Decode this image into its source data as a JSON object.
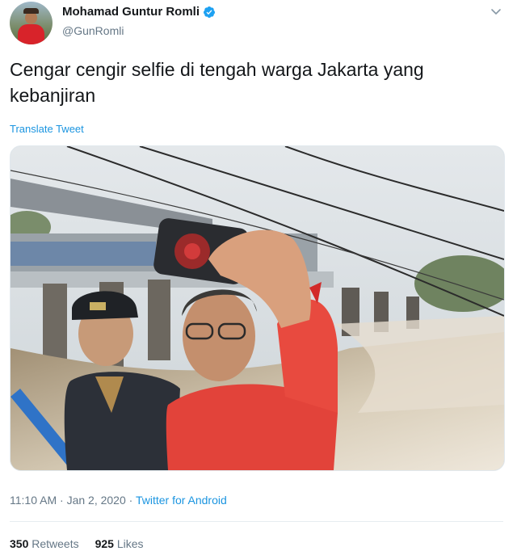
{
  "author": {
    "display_name": "Mohamad Guntur Romli",
    "handle": "@GunRomli"
  },
  "tweet": {
    "text": "Cengar cengir selfie di tengah warga Jakarta yang kebanjiran",
    "translate_label": "Translate Tweet"
  },
  "meta": {
    "time": "11:10 AM",
    "separator1": " · ",
    "date": "Jan 2, 2020",
    "separator2": " · ",
    "source": "Twitter for Android"
  },
  "stats": {
    "retweets_count": "350",
    "retweets_label": "Retweets",
    "likes_count": "925",
    "likes_label": "Likes"
  },
  "icons": {
    "verified": "verified-badge-icon",
    "caret": "chevron-down-icon"
  },
  "colors": {
    "link": "#1b95e0",
    "secondary_text": "#657786",
    "verified": "#1da1f2"
  }
}
